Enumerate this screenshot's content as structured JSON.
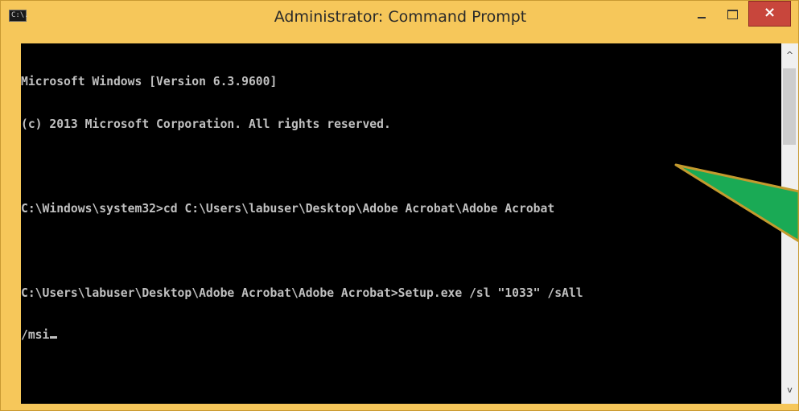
{
  "window": {
    "title": "Administrator: Command Prompt",
    "icon_label": "C:\\.",
    "title_bar_color": "#f6c75a",
    "close_glyph": "×"
  },
  "icons": {
    "app": "cmd-icon",
    "minimize": "minimize-icon",
    "maximize": "maximize-icon",
    "close": "close-icon",
    "scroll_up": "chevron-up-icon",
    "scroll_down": "chevron-down-icon",
    "annotation": "green-arrow"
  },
  "console": {
    "background": "#000000",
    "text_color": "#c0c0c0",
    "lines": [
      "Microsoft Windows [Version 6.3.9600]",
      "(c) 2013 Microsoft Corporation. All rights reserved.",
      "",
      "C:\\Windows\\system32>cd C:\\Users\\labuser\\Desktop\\Adobe Acrobat\\Adobe Acrobat",
      "",
      "C:\\Users\\labuser\\Desktop\\Adobe Acrobat\\Adobe Acrobat>Setup.exe /sl \"1033\" /sAll",
      "/msi"
    ]
  },
  "scrollbar": {
    "up_glyph": "^",
    "down_glyph": "v"
  },
  "annotation": {
    "arrow_color": "#1aaa55",
    "arrow_outline": "#c49a2e"
  }
}
